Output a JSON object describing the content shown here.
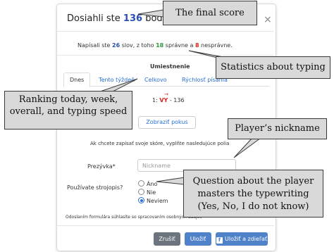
{
  "modal": {
    "title_prefix": "Dosiahli ste ",
    "score": "136",
    "title_suffix": " bodov!",
    "close": "×"
  },
  "stats": {
    "p1": "Napísali ste ",
    "words": "26",
    "p2": " slov, z toho ",
    "correct": "18",
    "p3": " správne a ",
    "wrong": "8",
    "p4": " nesprávne."
  },
  "ranking": {
    "heading": "Umiestnenie",
    "tabs": [
      "Dnes",
      "Tento týždeň",
      "Celkovo",
      "Rýchlosť písania"
    ],
    "arrow": "→",
    "row_prefix": "1: ",
    "row_name": "VY",
    "row_suffix": " - 136",
    "show_button": "Zobraziť pokus"
  },
  "form": {
    "note": "Ak chcete zapísať svoje skóre, vyplňte nasledujúce polia",
    "nick_label": "Prezývka*",
    "nick_placeholder": "Nickname",
    "question": "Používate strojopis?",
    "options": [
      "Áno",
      "Nie",
      "Neviem"
    ],
    "selected": "Neviem",
    "consent": "Odoslaním formulára súhlasíte so spracovaním osobných údajov"
  },
  "buttons": {
    "cancel": "Zrušiť",
    "save": "Uložiť",
    "save_share": "Uložiť a zdieľať",
    "share_icon": "f"
  },
  "callouts": {
    "score": "The final score",
    "stats": "Statistics about typing",
    "ranking_l1": "Ranking today, week,",
    "ranking_l2": "overall, and typing speed",
    "nickname": "Player’s nickname",
    "question_l1": "Question about the player",
    "question_l2": "masters the typewriting",
    "question_l3": "(Yes, No, I do not know)"
  }
}
